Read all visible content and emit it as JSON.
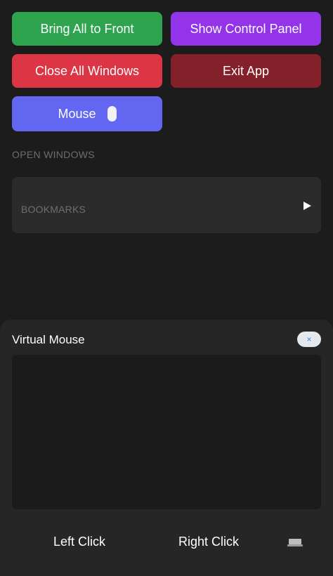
{
  "actions": {
    "bring_all_to_front": "Bring All to Front",
    "show_control_panel": "Show Control Panel",
    "close_all_windows": "Close All Windows",
    "exit_app": "Exit App",
    "mouse": "Mouse"
  },
  "colors": {
    "background": "#1c1c1c",
    "bring_all_to_front": "#2ea44f",
    "show_control_panel": "#9333ea",
    "close_all_windows": "#dc3545",
    "exit_app": "#84202a",
    "mouse": "#6366f1"
  },
  "open_windows": {
    "section_label": "OPEN WINDOWS",
    "items": [
      {
        "label": "BOOKMARKS",
        "icon": "play-icon"
      }
    ]
  },
  "virtual_mouse": {
    "title": "Virtual Mouse",
    "close_glyph": "×",
    "left_click": "Left Click",
    "right_click": "Right Click",
    "keyboard_icon": "keyboard-icon"
  }
}
